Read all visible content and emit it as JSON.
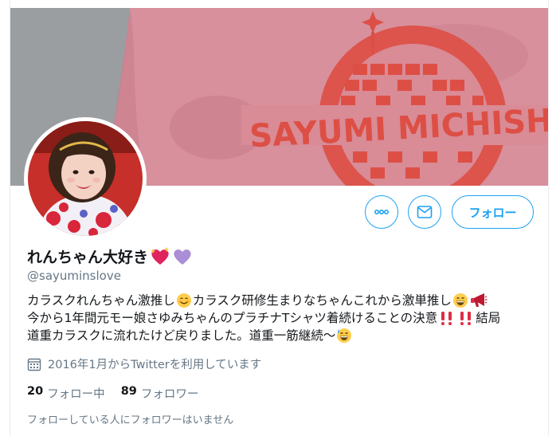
{
  "profile": {
    "display_name": "れんちゃん大好き",
    "name_emojis": [
      "sparkling-heart-icon",
      "purple-heart-icon"
    ],
    "handle": "@sayuminslove",
    "bio": {
      "line1": {
        "a": "カラスクれんちゃん激推し",
        "b": "カラスク研修生まりなちゃんこれから激単推し"
      },
      "line2": {
        "a": "今から1年間元モー娘さゆみちゃんのプラチナTシャツ着続けることの決意",
        "b": "結局"
      },
      "line3": {
        "a": "道重カラスクに流れたけど戻りました。道重一筋継続～"
      }
    },
    "joined": "2016年1月からTwitterを利用しています",
    "following_count": "20",
    "following_label": "フォロー中",
    "followers_count": "89",
    "followers_label": "フォロワー",
    "known_followers": "フォローしている人にフォロワーはいません"
  },
  "banner": {
    "shirt_text": "SAYUMI MICHISH"
  },
  "actions": {
    "more_icon": "more-icon",
    "message_icon": "envelope-icon",
    "follow_label": "フォロー"
  },
  "colors": {
    "accent": "#1da1f2",
    "shirt_pink": "#d9919e",
    "print_red": "#dd4f45"
  }
}
